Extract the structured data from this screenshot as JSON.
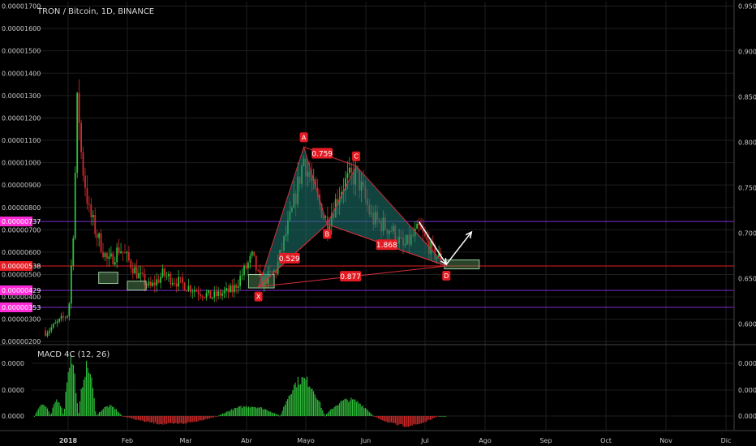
{
  "header": {
    "title": "TRON / Bitcoin, 1D, BINANCE"
  },
  "macd": {
    "title": "MACD 4C (12, 26)"
  },
  "colors": {
    "background": "#000000",
    "grid": "#1e1e1e",
    "text": "#c8c8c8",
    "up": "#2fbf3a",
    "down": "#d22a2a",
    "pattern_line": "#d0303b",
    "pattern_fill": "#1f7a72",
    "label_red": "#e31b23",
    "tag_magenta": "#ff2bd7",
    "purple_line": "#7a2bd0",
    "zone_green": "#4e8b50"
  },
  "chart_data": [
    {
      "type": "candlestick",
      "title": "TRON / Bitcoin, 1D, BINANCE",
      "x_ticks": [
        "2018",
        "Feb",
        "Mar",
        "Abr",
        "Mayo",
        "Jun",
        "Jul",
        "Ago",
        "Sep",
        "Oct",
        "Nov",
        "Dic"
      ],
      "left_axis": {
        "ticks": [
          "0.00000200",
          "0.00000300",
          "0.00000400",
          "0.00000500",
          "0.00000600",
          "0.00000700",
          "0.00000800",
          "0.00000900",
          "0.00001000",
          "0.00001100",
          "0.00001200",
          "0.00001300",
          "0.00001400",
          "0.00001500",
          "0.00001600",
          "0.00001700"
        ],
        "range": [
          1.9e-06,
          1.72e-05
        ]
      },
      "right_axis": {
        "ticks": [
          "0.6000",
          "0.6500",
          "0.7000",
          "0.7500",
          "0.8000",
          "0.8500",
          "0.9000",
          "0.9500"
        ],
        "range": [
          0.578,
          0.955
        ]
      },
      "price_tags": [
        {
          "label": "0.00000737",
          "value": 7.37e-06,
          "color": "#ff2bd7"
        },
        {
          "label": "0.00000538",
          "value": 5.38e-06,
          "color": "#e31b23"
        },
        {
          "label": "0.00000429",
          "value": 4.29e-06,
          "color": "#ff2bd7"
        },
        {
          "label": "0.00000353",
          "value": 3.53e-06,
          "color": "#ff2bd7"
        }
      ],
      "harmonic_pattern": {
        "points": [
          {
            "name": "X",
            "date": "2018-04-07",
            "price": 4.45e-06
          },
          {
            "name": "A",
            "date": "2018-04-30",
            "price": 1.07e-05
          },
          {
            "name": "B",
            "date": "2018-05-12",
            "price": 7.25e-06
          },
          {
            "name": "C",
            "date": "2018-05-27",
            "price": 9.85e-06
          },
          {
            "name": "D",
            "date": "2018-07-12",
            "price": 5.38e-06
          }
        ],
        "ratios": [
          {
            "label": "0.759",
            "legs": "XA-AB"
          },
          {
            "label": "0.529",
            "legs": "AB-BC"
          },
          {
            "label": "1.868",
            "legs": "BC-CD"
          },
          {
            "label": "0.877",
            "legs": "XA-XD"
          }
        ]
      },
      "support_zones": [
        {
          "start": "2018-01-17",
          "end": "2018-01-27",
          "low": 4.6e-06,
          "high": 5.1e-06
        },
        {
          "start": "2018-02-01",
          "end": "2018-02-10",
          "low": 4.3e-06,
          "high": 4.7e-06
        },
        {
          "start": "2018-04-02",
          "end": "2018-04-15",
          "low": 4.4e-06,
          "high": 5e-06
        },
        {
          "start": "2018-07-11",
          "end": "2018-07-29",
          "low": 5.25e-06,
          "high": 5.65e-06
        }
      ],
      "projection_arrows": [
        {
          "from": {
            "date": "2018-06-28",
            "price": 7.35e-06
          },
          "to": {
            "date": "2018-07-12",
            "price": 5.45e-06
          }
        },
        {
          "from": {
            "date": "2018-07-12",
            "price": 5.45e-06
          },
          "to": {
            "date": "2018-07-25",
            "price": 6.9e-06
          }
        }
      ]
    },
    {
      "type": "histogram",
      "title": "MACD 4C (12, 26)",
      "y_ticks": [
        "0.0000",
        "0.0000",
        "0.0000"
      ]
    }
  ]
}
